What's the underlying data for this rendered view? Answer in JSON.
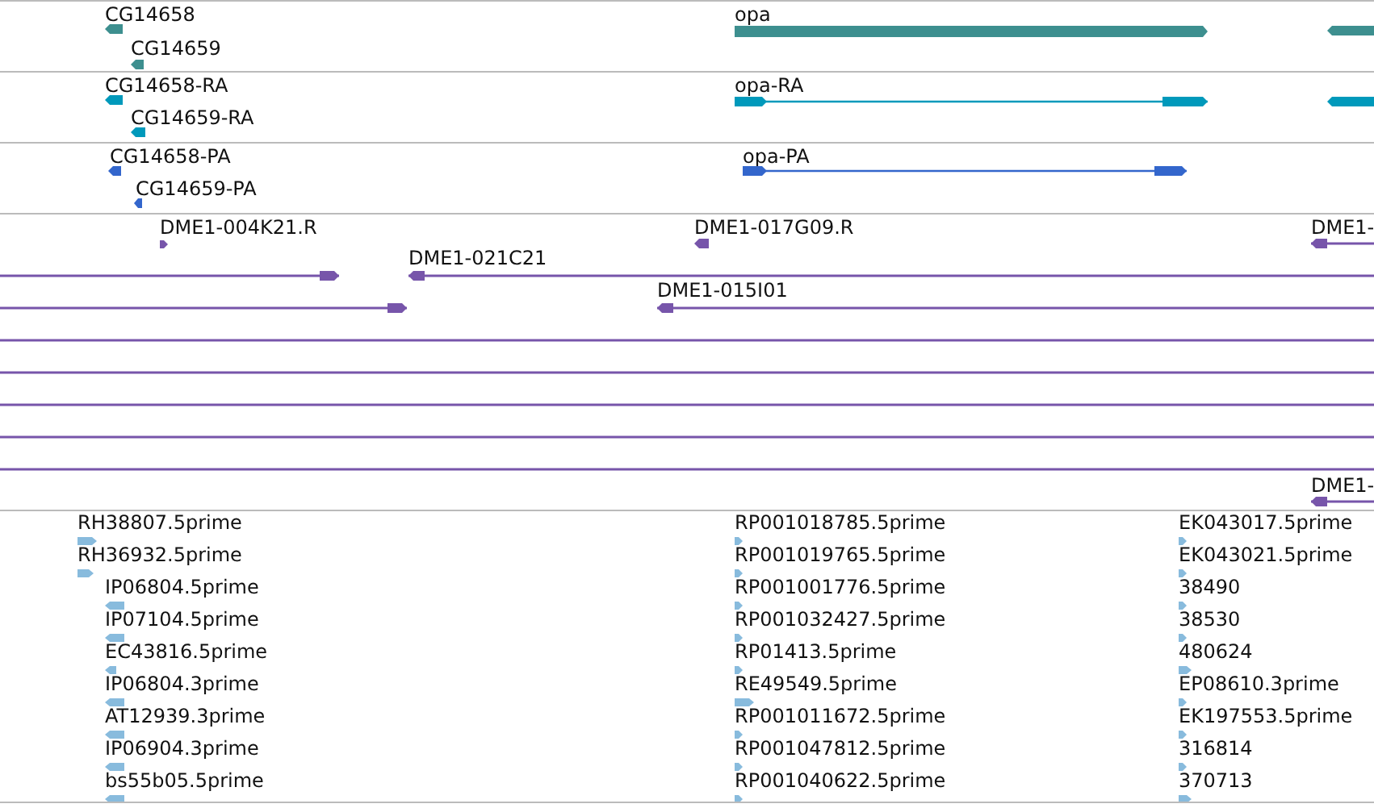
{
  "tracks": [
    {
      "color": "#3d8f8f",
      "features": [
        {
          "label": "CG14658",
          "kind": "block",
          "forward": false
        },
        {
          "label": "CG14659",
          "kind": "block",
          "forward": false
        },
        {
          "label": "opa",
          "kind": "block",
          "forward": true
        },
        {
          "kind": "block",
          "forward": false
        }
      ]
    },
    {
      "color": "#0099bb",
      "features": [
        {
          "label": "CG14658-RA",
          "kind": "block",
          "forward": false
        },
        {
          "label": "CG14659-RA",
          "kind": "block",
          "forward": false
        },
        {
          "label": "opa-RA",
          "kind": "spliced",
          "forward": true
        },
        {
          "kind": "block",
          "forward": false
        }
      ]
    },
    {
      "color": "#3366cc",
      "features": [
        {
          "label": "CG14658-PA",
          "kind": "block",
          "forward": false
        },
        {
          "label": "CG14659-PA",
          "kind": "block",
          "forward": false
        },
        {
          "label": "opa-PA",
          "kind": "spliced",
          "forward": true
        }
      ]
    },
    {
      "color": "#7755aa",
      "features": [
        {
          "label": "DME1-004K21.R",
          "kind": "block",
          "forward": true
        },
        {
          "kind": "span",
          "forward": true
        },
        {
          "label": "DME1-021C21",
          "kind": "span",
          "forward": false
        },
        {
          "label": "DME1-017G09.R",
          "kind": "block",
          "forward": false
        },
        {
          "label": "DME1-",
          "kind": "span",
          "forward": false
        },
        {
          "kind": "span",
          "forward": true
        },
        {
          "label": "DME1-015I01",
          "kind": "span",
          "forward": false
        },
        {
          "kind": "line"
        },
        {
          "kind": "line"
        },
        {
          "kind": "line"
        },
        {
          "kind": "line"
        },
        {
          "kind": "line"
        },
        {
          "label": "DME1-",
          "kind": "span",
          "forward": false
        }
      ]
    },
    {
      "color": "#88bbdd",
      "features": [
        {
          "label": "RH38807.5prime",
          "kind": "block",
          "forward": true
        },
        {
          "label": "RH36932.5prime",
          "kind": "block",
          "forward": true
        },
        {
          "label": "IP06804.5prime",
          "kind": "block",
          "forward": false
        },
        {
          "label": "IP07104.5prime",
          "kind": "block",
          "forward": false
        },
        {
          "label": "EC43816.5prime",
          "kind": "block",
          "forward": false
        },
        {
          "label": "IP06804.3prime",
          "kind": "block",
          "forward": false
        },
        {
          "label": "AT12939.3prime",
          "kind": "block",
          "forward": false
        },
        {
          "label": "IP06904.3prime",
          "kind": "block",
          "forward": false
        },
        {
          "label": "bs55b05.5prime",
          "kind": "block",
          "forward": false
        },
        {
          "label": "RP001018785.5prime",
          "kind": "block",
          "forward": true
        },
        {
          "label": "RP001019765.5prime",
          "kind": "block",
          "forward": true
        },
        {
          "label": "RP001001776.5prime",
          "kind": "block",
          "forward": true
        },
        {
          "label": "RP001032427.5prime",
          "kind": "block",
          "forward": true
        },
        {
          "label": "RP01413.5prime",
          "kind": "block",
          "forward": true
        },
        {
          "label": "RE49549.5prime",
          "kind": "block",
          "forward": true
        },
        {
          "label": "RP001011672.5prime",
          "kind": "block",
          "forward": true
        },
        {
          "label": "RP001047812.5prime",
          "kind": "block",
          "forward": true
        },
        {
          "label": "RP001040622.5prime",
          "kind": "block",
          "forward": true
        },
        {
          "label": "EK043017.5prime",
          "kind": "block",
          "forward": true
        },
        {
          "label": "EK043021.5prime",
          "kind": "block",
          "forward": true
        },
        {
          "label": "38490",
          "kind": "block",
          "forward": true
        },
        {
          "label": "38530",
          "kind": "block",
          "forward": true
        },
        {
          "label": "480624",
          "kind": "block",
          "forward": true
        },
        {
          "label": "EP08610.3prime",
          "kind": "block",
          "forward": true
        },
        {
          "label": "EK197553.5prime",
          "kind": "block",
          "forward": true
        },
        {
          "label": "316814",
          "kind": "block",
          "forward": true
        },
        {
          "label": "370713",
          "kind": "block",
          "forward": true
        }
      ]
    }
  ]
}
